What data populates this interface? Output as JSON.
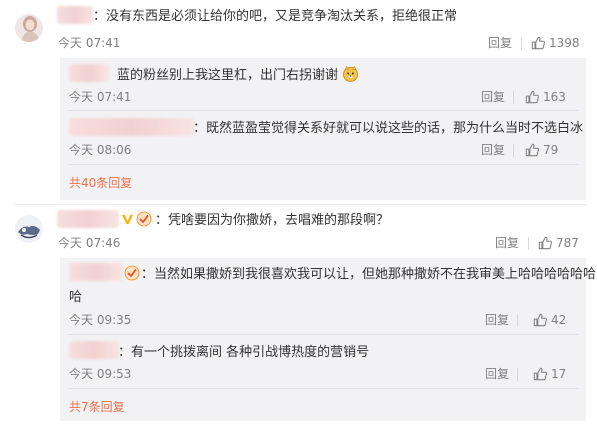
{
  "threads": [
    {
      "comment": {
        "text": "：没有东西是必须让给你的吧，又是竞争淘汰关系，拒绝很正常",
        "time": "今天 07:41",
        "reply_label": "回复",
        "likes": "1398"
      },
      "replies": [
        {
          "text": "蓝的粉丝别上我这里杠，出门右拐谢谢",
          "time": "今天 07:41",
          "reply_label": "回复",
          "likes": "163"
        },
        {
          "text": "：既然蓝盈莹觉得关系好就可以说这些的话，那为什么当时不选白冰",
          "time": "今天 08:06",
          "reply_label": "回复",
          "likes": "79"
        }
      ],
      "more": "共40条回复"
    },
    {
      "comment": {
        "text": "：凭啥要因为你撒娇，去唱难的那段啊？",
        "time": "今天 07:46",
        "reply_label": "回复",
        "likes": "787"
      },
      "replies": [
        {
          "text_line1": "：当然如果撒娇到我很喜欢我可以让，但她那种撒娇不在我审美上哈哈哈哈哈哈",
          "text_line2": "哈",
          "time": "今天 09:35",
          "reply_label": "回复",
          "likes": "42"
        },
        {
          "text": "：有一个挑拨离间 各种引战博热度的营销号",
          "time": "今天 09:53",
          "reply_label": "回复",
          "likes": "17"
        }
      ],
      "more": "共7条回复"
    }
  ],
  "colors": {
    "more_link": "#eb7350",
    "reply_bg": "#f2f2f5",
    "meta_text": "#808080",
    "verified_v": "#f6b400"
  },
  "icons": [
    "thumb-up-icon",
    "verified-v-icon",
    "fan-badge-icon",
    "doge-emoji-icon"
  ]
}
